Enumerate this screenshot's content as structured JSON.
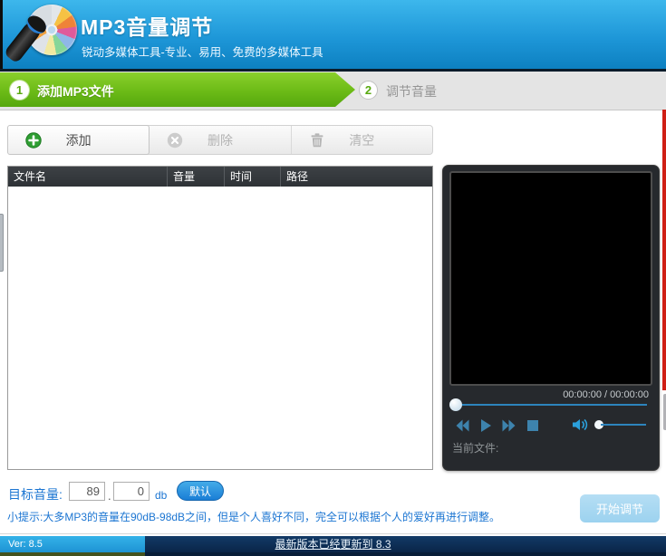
{
  "header": {
    "title": "MP3音量调节",
    "subtitle": "锐动多媒体工具-专业、易用、免费的多媒体工具"
  },
  "steps": [
    {
      "number": "1",
      "label": "添加MP3文件"
    },
    {
      "number": "2",
      "label": "调节音量"
    }
  ],
  "toolbar": {
    "add_label": "添加",
    "delete_label": "删除",
    "clear_label": "清空"
  },
  "table": {
    "columns": [
      "文件名",
      "音量",
      "时间",
      "路径"
    ],
    "rows": []
  },
  "player": {
    "time": "00:00:00 / 00:00:00",
    "current_file_label": "当前文件:"
  },
  "target": {
    "label": "目标音量:",
    "value_int": "89",
    "separator": ".",
    "value_dec": "0",
    "unit": "db",
    "default_button": "默认"
  },
  "tip": "小提示:大多MP3的音量在90dB-98dB之间，但是个人喜好不同，完全可以根据个人的爱好再进行调整。",
  "start_button": "开始调节",
  "statusbar": {
    "version": "Ver: 8.5",
    "update_link": "最新版本已经更新到 8.3"
  },
  "icons": {
    "logo": "cd-with-microphone-icon",
    "add": "plus-circle-icon",
    "delete": "x-circle-icon",
    "clear": "trash-icon",
    "rewind": "rewind-icon",
    "play": "play-icon",
    "forward": "fast-forward-icon",
    "stop": "stop-icon",
    "volume": "speaker-icon"
  },
  "colors": {
    "header_blue_top": "#3db7ec",
    "header_blue_bottom": "#0d80c1",
    "step_green": "#6cbb17",
    "step_gray": "#e4e4e4",
    "table_header_dark": "#33373b",
    "player_panel": "#26292d",
    "accent_blue": "#1b75d2",
    "player_control_blue": "#3d83ad",
    "status_light_blue": "#2daae2",
    "status_navy": "#0c2b50",
    "start_button_blue": "#a6d8f2",
    "red_edge_line": "#cf1f15"
  }
}
